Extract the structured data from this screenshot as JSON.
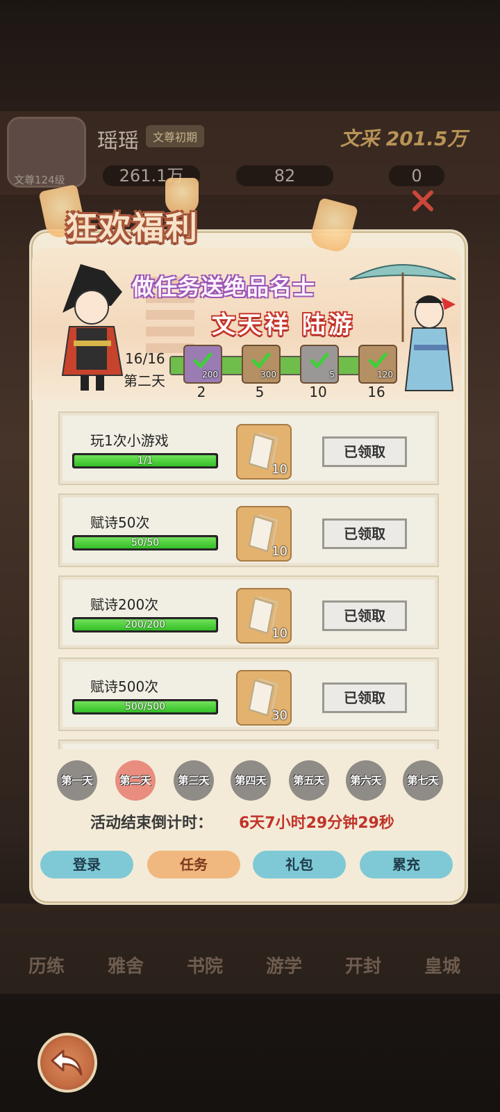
{
  "background": {
    "player_name": "瑶瑶",
    "rank": "文尊初期",
    "power": "文采 201.5万",
    "level": "文尊124级",
    "resources": [
      "261.1万",
      "82",
      "0"
    ],
    "nav": [
      "历练",
      "雅舍",
      "书院",
      "游学",
      "开封",
      "皇城"
    ]
  },
  "modal": {
    "title": "狂欢福利",
    "subtitle": "做任务送绝品名士",
    "heroes": "文天祥  陆游",
    "progress": {
      "count": "16/16",
      "day": "第二天",
      "fraction": 1.0,
      "milestones": [
        {
          "reward": "200",
          "step": "2"
        },
        {
          "reward": "300",
          "step": "5"
        },
        {
          "reward": "5",
          "step": "10"
        },
        {
          "reward": "120",
          "step": "16"
        }
      ]
    },
    "tasks": [
      {
        "label": "玩1次小游戏",
        "progress": "1/1",
        "ratio": 1.0,
        "reward": "10",
        "button": "已领取"
      },
      {
        "label": "赋诗50次",
        "progress": "50/50",
        "ratio": 1.0,
        "reward": "10",
        "button": "已领取"
      },
      {
        "label": "赋诗200次",
        "progress": "200/200",
        "ratio": 1.0,
        "reward": "10",
        "button": "已领取"
      },
      {
        "label": "赋诗500次",
        "progress": "500/500",
        "ratio": 1.0,
        "reward": "30",
        "button": "已领取"
      }
    ],
    "days": [
      "第一天",
      "第二天",
      "第三天",
      "第四天",
      "第五天",
      "第六天",
      "第七天"
    ],
    "active_day": 1,
    "countdown_label": "活动结束倒计时：",
    "countdown_value": "6天7小时29分钟29秒",
    "tabs": [
      "登录",
      "任务",
      "礼包",
      "累充"
    ]
  },
  "colors": {
    "modal_bg": "#f3ebd8",
    "countdown": "#c0332a",
    "progress_green": "#33c026",
    "tab_blue": "#7fc9d6",
    "tab_active": "#f0b87e"
  }
}
